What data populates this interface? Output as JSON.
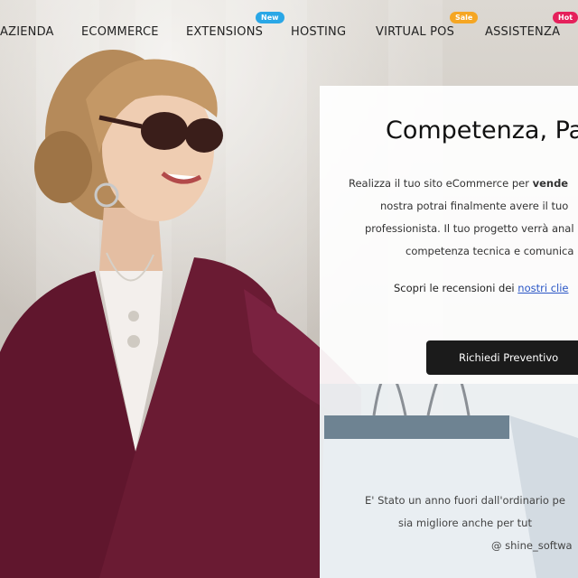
{
  "nav": {
    "items": [
      {
        "label": "AZIENDA",
        "badge": null
      },
      {
        "label": "ECOMMERCE",
        "badge": null
      },
      {
        "label": "EXTENSIONS",
        "badge": {
          "text": "New",
          "color": "#2aa7e6"
        }
      },
      {
        "label": "HOSTING",
        "badge": null
      },
      {
        "label": "VIRTUAL POS",
        "badge": {
          "text": "Sale",
          "color": "#f5a623"
        }
      },
      {
        "label": "ASSISTENZA",
        "badge": {
          "text": "Hot",
          "color": "#e5205b"
        }
      }
    ]
  },
  "hero": {
    "headline": "Competenza, Pa",
    "paragraph": {
      "line1_pre": "Realizza il tuo sito eCommerce per ",
      "line1_bold": "vende",
      "line2": "nostra potrai finalmente avere il tuo",
      "line3": "professionista. Il tuo progetto verrà anal",
      "line4": "competenza tecnica e comunica"
    },
    "reviews_text": "Scopri le recensioni dei ",
    "reviews_link": "nostri clie",
    "cta_label": "Richiedi Preventivo"
  },
  "testimonial": {
    "line1": "E' Stato un anno fuori dall'ordinario pe",
    "line2": "sia migliore anche per tut",
    "line3": "@ shine_softwa"
  },
  "colors": {
    "accent_link": "#2a56c6",
    "cta_bg": "#1b1b1b",
    "dress": "#6a1b33"
  }
}
